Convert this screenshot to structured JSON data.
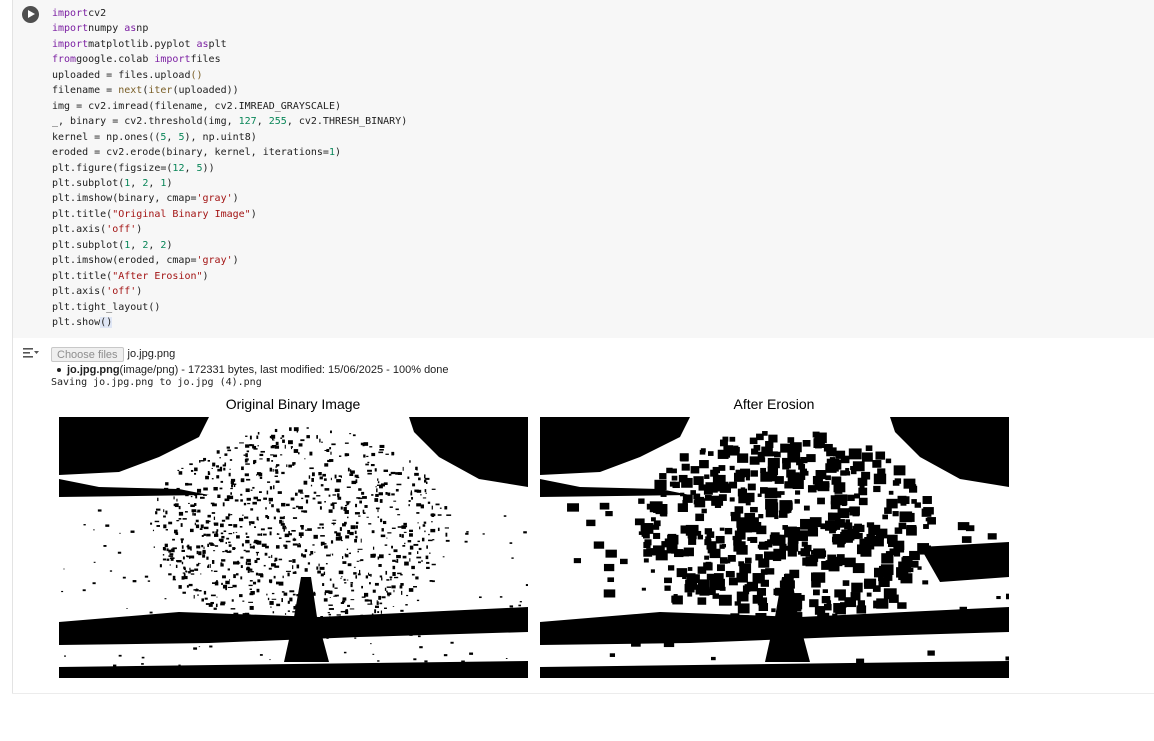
{
  "cell": {
    "run_icon": "play-circle-icon",
    "code_lines": [
      [
        [
          "kw",
          "import"
        ],
        [
          "",
          "cv2"
        ]
      ],
      [
        [
          "kw",
          "import"
        ],
        [
          "",
          "numpy "
        ],
        [
          "kw",
          "as"
        ],
        [
          "",
          "np"
        ]
      ],
      [
        [
          "kw",
          "import"
        ],
        [
          "",
          "matplotlib.pyplot "
        ],
        [
          "kw",
          "as"
        ],
        [
          "",
          "plt"
        ]
      ],
      [
        [
          "kw",
          "from"
        ],
        [
          "",
          "google.colab "
        ],
        [
          "kw",
          "import"
        ],
        [
          "",
          "files"
        ]
      ],
      [
        [
          "",
          "uploaded = files.upload"
        ],
        [
          "fn",
          "()"
        ]
      ],
      [
        [
          "",
          "filename = "
        ],
        [
          "fn",
          "next"
        ],
        [
          "",
          "("
        ],
        [
          "fn",
          "iter"
        ],
        [
          "",
          "(uploaded))"
        ]
      ],
      [
        [
          "",
          "img = cv2.imread(filename, cv2.IMREAD_GRAYSCALE)"
        ]
      ],
      [
        [
          "",
          "_, binary = cv2.threshold(img, "
        ],
        [
          "num",
          "127"
        ],
        [
          "",
          ", "
        ],
        [
          "num",
          "255"
        ],
        [
          "",
          ", cv2.THRESH_BINARY)"
        ]
      ],
      [
        [
          "",
          "kernel = np.ones(("
        ],
        [
          "num",
          "5"
        ],
        [
          "",
          ", "
        ],
        [
          "num",
          "5"
        ],
        [
          "",
          "), np.uint8)"
        ]
      ],
      [
        [
          "",
          "eroded = cv2.erode(binary, kernel, iterations="
        ],
        [
          "num",
          "1"
        ],
        [
          "",
          ")"
        ]
      ],
      [
        [
          "",
          "plt.figure(figsize=("
        ],
        [
          "num",
          "12"
        ],
        [
          "",
          ", "
        ],
        [
          "num",
          "5"
        ],
        [
          "",
          "))"
        ]
      ],
      [
        [
          "",
          "plt.subplot("
        ],
        [
          "num",
          "1"
        ],
        [
          "",
          ", "
        ],
        [
          "num",
          "2"
        ],
        [
          "",
          ", "
        ],
        [
          "num",
          "1"
        ],
        [
          "",
          ")"
        ]
      ],
      [
        [
          "",
          "plt.imshow(binary, cmap="
        ],
        [
          "str",
          "'gray'"
        ],
        [
          "",
          ")"
        ]
      ],
      [
        [
          "",
          "plt.title("
        ],
        [
          "str",
          "\"Original Binary Image\""
        ],
        [
          "",
          ")"
        ]
      ],
      [
        [
          "",
          "plt.axis("
        ],
        [
          "str",
          "'off'"
        ],
        [
          "",
          ")"
        ]
      ],
      [
        [
          "",
          "plt.subplot("
        ],
        [
          "num",
          "1"
        ],
        [
          "",
          ", "
        ],
        [
          "num",
          "2"
        ],
        [
          "",
          ", "
        ],
        [
          "num",
          "2"
        ],
        [
          "",
          ")"
        ]
      ],
      [
        [
          "",
          "plt.imshow(eroded, cmap="
        ],
        [
          "str",
          "'gray'"
        ],
        [
          "",
          ")"
        ]
      ],
      [
        [
          "",
          "plt.title("
        ],
        [
          "str",
          "\"After Erosion\""
        ],
        [
          "",
          ")"
        ]
      ],
      [
        [
          "",
          "plt.axis("
        ],
        [
          "str",
          "'off'"
        ],
        [
          "",
          ")"
        ]
      ],
      [
        [
          "",
          "plt.tight_layout()"
        ]
      ],
      [
        [
          "",
          "plt.show"
        ],
        [
          "caret-on",
          "()"
        ]
      ]
    ]
  },
  "output": {
    "toggle_icon": "output-toggle-icon",
    "choose_files_label": "Choose files",
    "selected_file": "jo.jpg.png",
    "file_info_name": "jo.jpg.png",
    "file_info_rest": "(image/png) - 172331 bytes, last modified: 15/06/2025 - 100% done",
    "saving_text": "Saving jo.jpg.png to jo.jpg (4).png",
    "plots": [
      {
        "title": "Original Binary Image"
      },
      {
        "title": "After Erosion"
      }
    ]
  }
}
